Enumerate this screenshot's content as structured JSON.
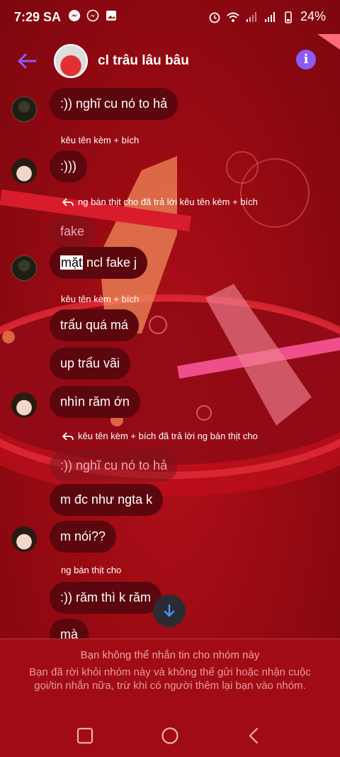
{
  "status_bar": {
    "time": "7:29 SA",
    "battery": "24%"
  },
  "header": {
    "group_name": "cl trâu lâu bâu"
  },
  "messages": [
    {
      "text": ":)) nghĩ cu nó to hả"
    },
    {
      "sender": "kêu tên kèm + bích"
    },
    {
      "text": ":)))"
    },
    {
      "reply_note": "ng bán thịt cho đã trả lời kêu tên kèm + bích"
    },
    {
      "quoted": "fake"
    },
    {
      "text_highlight": "mặt",
      "text_rest": " ncl fake j"
    },
    {
      "sender": "kêu tên kèm + bích"
    },
    {
      "text": "trẩu quá má"
    },
    {
      "text": "up trẩu vãi"
    },
    {
      "text": "nhìn răm ớn"
    },
    {
      "reply_note": "kêu tên kèm + bích đã trả lời ng bán thịt cho"
    },
    {
      "quoted": ":)) nghĩ cu nó to hả"
    },
    {
      "text": "m đc như ngta k"
    },
    {
      "text": "m nói??"
    },
    {
      "sender": "ng bán thịt cho"
    },
    {
      "text": ":)) răm thì k răm"
    },
    {
      "text": "mà"
    }
  ],
  "footer": {
    "title": "Bạn không thể nhắn tin cho nhóm này",
    "description": "Bạn đã rời khỏi nhóm này và không thể gửi hoặc nhận cuộc gọi/tin nhắn nữa, trừ khi có người thêm lại bạn vào nhóm."
  },
  "icons": [
    "messenger-icon",
    "gallery-icon",
    "alarm-icon",
    "wifi-icon",
    "signal-icon",
    "battery-icon",
    "back-arrow-icon",
    "info-icon",
    "reply-arrow-icon",
    "arrow-down-icon",
    "recent-apps-icon",
    "home-icon",
    "back-nav-icon"
  ],
  "colors": {
    "background": "#9a0a12",
    "bubble": "#5c060d",
    "accent": "#8b5cf6"
  }
}
